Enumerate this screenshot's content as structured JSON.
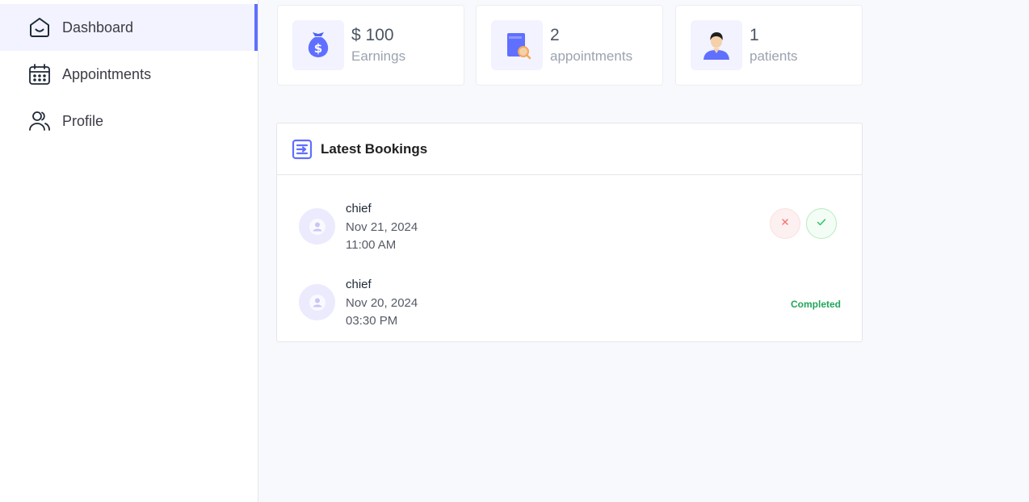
{
  "sidebar": {
    "items": [
      {
        "label": "Dashboard",
        "icon": "home-icon",
        "active": true
      },
      {
        "label": "Appointments",
        "icon": "calendar-icon",
        "active": false
      },
      {
        "label": "Profile",
        "icon": "people-icon",
        "active": false
      }
    ]
  },
  "stats": [
    {
      "value": "$ 100",
      "label": "Earnings",
      "icon": "money-bag-icon"
    },
    {
      "value": "2",
      "label": "appointments",
      "icon": "book-icon"
    },
    {
      "value": "1",
      "label": "patients",
      "icon": "patient-icon"
    }
  ],
  "bookings": {
    "title": "Latest Bookings",
    "rows": [
      {
        "name": "chief",
        "date": "Nov 21, 2024",
        "time": "11:00 AM",
        "status": ""
      },
      {
        "name": "chief",
        "date": "Nov 20, 2024",
        "time": "03:30 PM",
        "status": "Completed"
      }
    ]
  },
  "colors": {
    "accent": "#5f6fff",
    "cancel": "#f87171",
    "accept": "#22c55e",
    "completed": "#22a55b"
  }
}
